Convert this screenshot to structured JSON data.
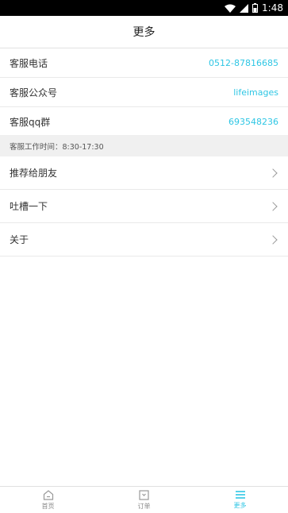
{
  "status_bar": {
    "time": "1:48"
  },
  "header": {
    "title": "更多"
  },
  "contact_rows": [
    {
      "label": "客服电话",
      "value": "0512-87816685"
    },
    {
      "label": "客服公众号",
      "value": "lifeimages"
    },
    {
      "label": "客服qq群",
      "value": "693548236"
    }
  ],
  "hint": "客服工作时间：8:30-17:30",
  "menu_rows": [
    {
      "label": "推荐给朋友"
    },
    {
      "label": "吐槽一下"
    },
    {
      "label": "关于"
    }
  ],
  "tabs": [
    {
      "label": "首页",
      "icon": "home-icon"
    },
    {
      "label": "订单",
      "icon": "order-icon"
    },
    {
      "label": "更多",
      "icon": "more-icon"
    }
  ],
  "colors": {
    "accent": "#2ec6e4",
    "divider": "#e9e9e9",
    "hint_bg": "#f0f0f0"
  }
}
